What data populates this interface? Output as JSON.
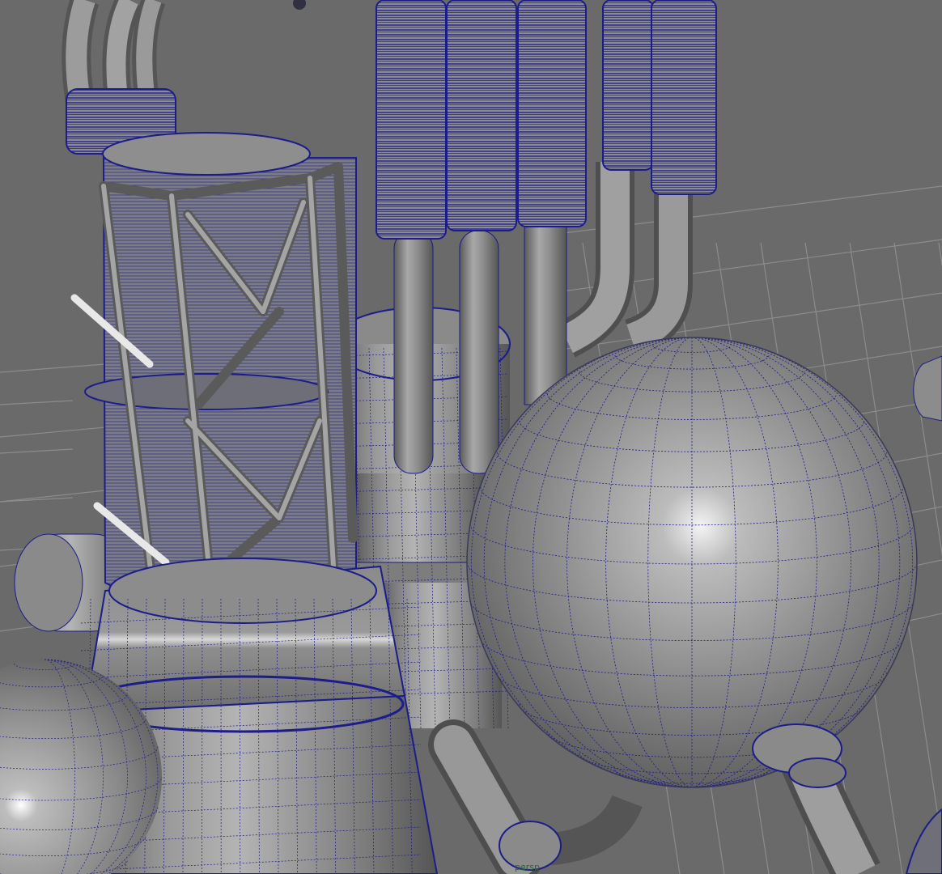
{
  "viewport": {
    "camera_label": "persp",
    "background_color": "#6a6a6a",
    "grid_color": "#8a8a8a",
    "mesh_color": "#8e8e8e",
    "wire_color": "#1c1c8a"
  },
  "scene_objects": [
    {
      "name": "ground-grid",
      "kind": "grid"
    },
    {
      "name": "caged-cylinder-tank",
      "kind": "mesh"
    },
    {
      "name": "central-reactor-body",
      "kind": "mesh"
    },
    {
      "name": "large-sphere-tank",
      "kind": "mesh"
    },
    {
      "name": "ribbed-vertical-pipes",
      "kind": "mesh"
    },
    {
      "name": "curved-pipes-top-left",
      "kind": "mesh"
    },
    {
      "name": "small-sphere-bottom-left",
      "kind": "mesh"
    },
    {
      "name": "side-nozzle-left",
      "kind": "mesh"
    },
    {
      "name": "bottom-connector-pipes",
      "kind": "mesh"
    }
  ]
}
